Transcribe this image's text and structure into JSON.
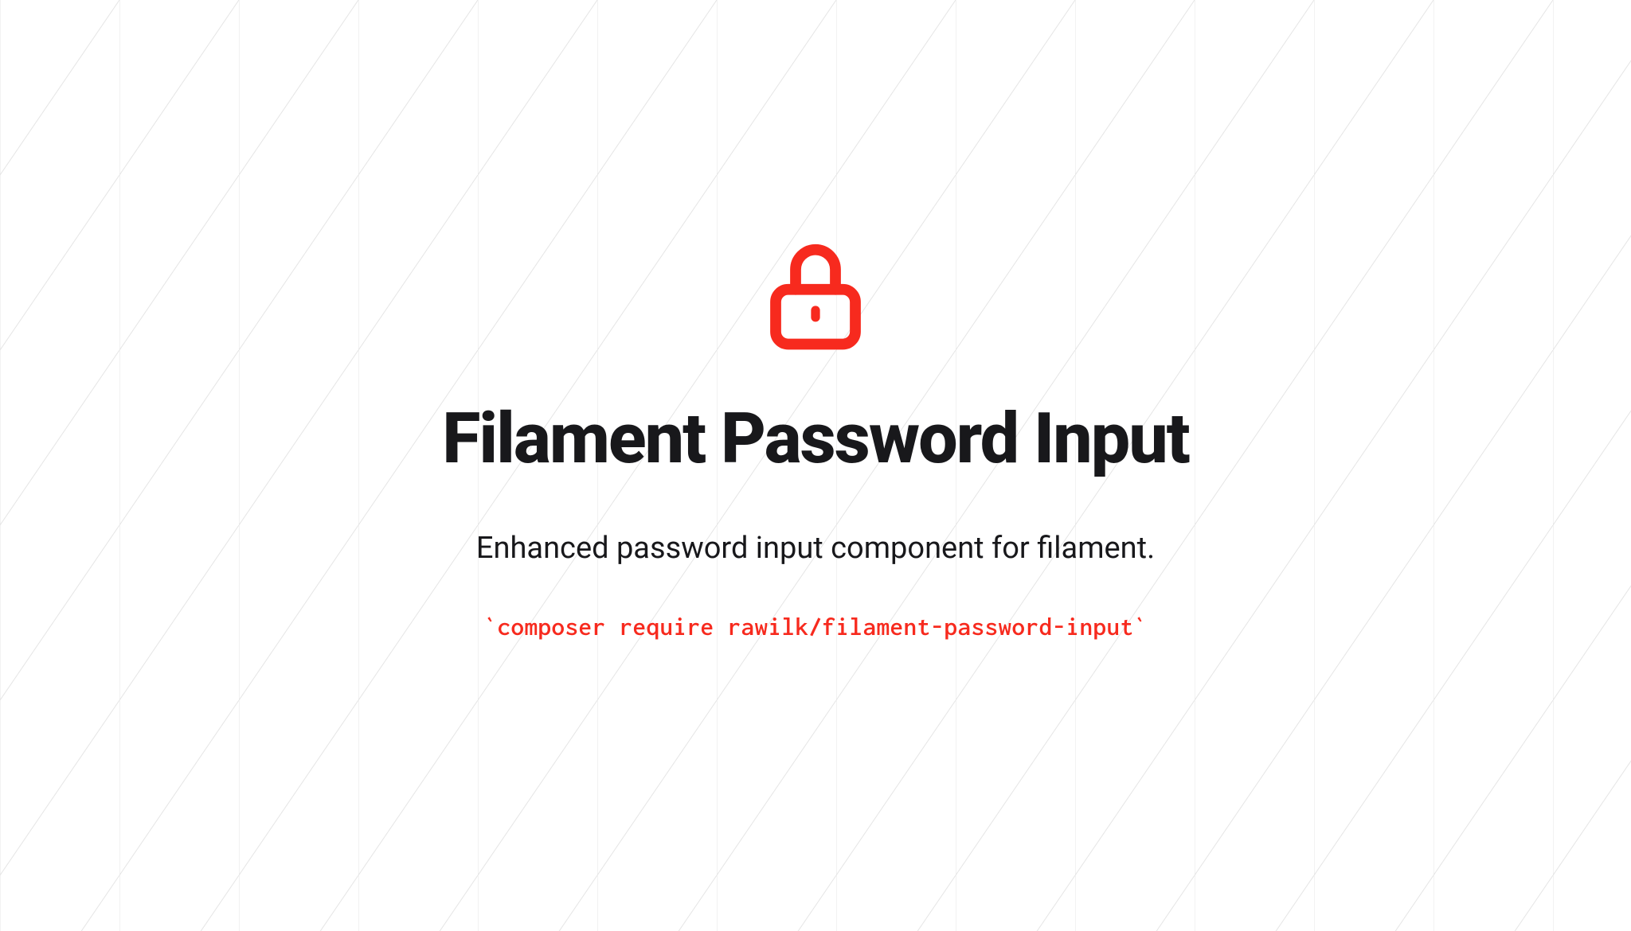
{
  "title": "Filament Password Input",
  "description": "Enhanced password input component for filament.",
  "command": "`composer require rawilk/filament-password-input`",
  "accent_color": "#f72a1e"
}
